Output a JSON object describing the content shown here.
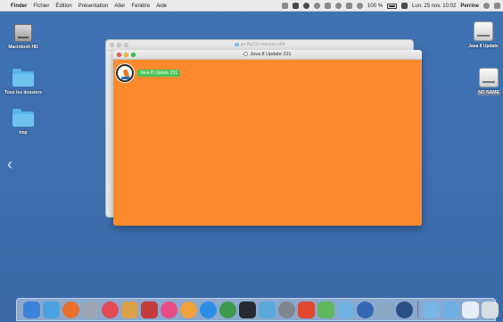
{
  "menubar": {
    "finder": "Finder",
    "items": [
      "Fichier",
      "Édition",
      "Présentation",
      "Aller",
      "Fenêtre",
      "Aide"
    ],
    "battery": "100 %",
    "datetime": "Lun. 25 nov. 10:02",
    "user": "Perrine"
  },
  "desktop": {
    "left_icons": [
      "Macintosh HD",
      "Tous les dossiers",
      "tmp"
    ],
    "right_icons": [
      "Java 8 Update",
      "NO NAME"
    ]
  },
  "back_window": {
    "title": "jre-8u231-macosx-x64"
  },
  "front_window": {
    "title": "Java 8 Update 231",
    "package_label": "Java 8 Update 231"
  },
  "dock": {
    "apps": [
      {
        "icon": "finder-icon",
        "color": "#3b83d8"
      },
      {
        "icon": "launchpad-icon",
        "color": "#4aa3e0"
      },
      {
        "icon": "firefox-icon",
        "color": "#e8702a"
      },
      {
        "icon": "photos-capture-icon",
        "color": "#9aa6b3"
      },
      {
        "icon": "safari-icon",
        "color": "#e24a54"
      },
      {
        "icon": "chess-icon",
        "color": "#d9a24a"
      },
      {
        "icon": "photo-booth-icon",
        "color": "#c43b3b"
      },
      {
        "icon": "itunes-icon",
        "color": "#e94b86"
      },
      {
        "icon": "photos-icon",
        "color": "#f0a13b"
      },
      {
        "icon": "app-store-icon",
        "color": "#2d8de6"
      },
      {
        "icon": "chrome-icon",
        "color": "#3d9a4d"
      },
      {
        "icon": "calculator-icon",
        "color": "#262a30"
      },
      {
        "icon": "telegram-icon",
        "color": "#5aa9d9"
      },
      {
        "icon": "system-preferences-icon",
        "color": "#7d8790"
      },
      {
        "icon": "messages-icon",
        "color": "#e0482f"
      },
      {
        "icon": "maps-icon",
        "color": "#5fb85e"
      },
      {
        "icon": "preview-icon",
        "color": "#6fb3e2"
      },
      {
        "icon": "network-utility-icon",
        "color": "#3468b5"
      },
      {
        "icon": "image-capture-icon",
        "color": "#8aa8c4"
      },
      {
        "icon": "quicktime-icon",
        "color": "#2a4e86"
      }
    ],
    "right_items": [
      {
        "icon": "downloads-folder-icon",
        "color": "#78b6e6"
      },
      {
        "icon": "applications-folder-icon",
        "color": "#6fb0e4"
      },
      {
        "icon": "documents-stack-icon",
        "color": "#e6eef6"
      },
      {
        "icon": "trash-icon",
        "color": "#d8dde2"
      }
    ]
  }
}
